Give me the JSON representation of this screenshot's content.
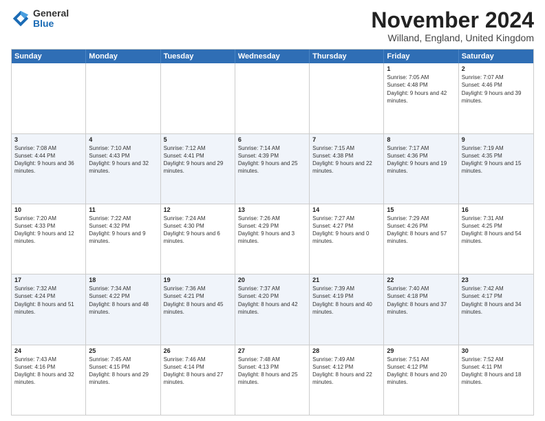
{
  "header": {
    "logo_general": "General",
    "logo_blue": "Blue",
    "month_title": "November 2024",
    "location": "Willand, England, United Kingdom"
  },
  "calendar": {
    "weekdays": [
      "Sunday",
      "Monday",
      "Tuesday",
      "Wednesday",
      "Thursday",
      "Friday",
      "Saturday"
    ],
    "weeks": [
      [
        {
          "day": "",
          "sunrise": "",
          "sunset": "",
          "daylight": ""
        },
        {
          "day": "",
          "sunrise": "",
          "sunset": "",
          "daylight": ""
        },
        {
          "day": "",
          "sunrise": "",
          "sunset": "",
          "daylight": ""
        },
        {
          "day": "",
          "sunrise": "",
          "sunset": "",
          "daylight": ""
        },
        {
          "day": "",
          "sunrise": "",
          "sunset": "",
          "daylight": ""
        },
        {
          "day": "1",
          "sunrise": "Sunrise: 7:05 AM",
          "sunset": "Sunset: 4:48 PM",
          "daylight": "Daylight: 9 hours and 42 minutes."
        },
        {
          "day": "2",
          "sunrise": "Sunrise: 7:07 AM",
          "sunset": "Sunset: 4:46 PM",
          "daylight": "Daylight: 9 hours and 39 minutes."
        }
      ],
      [
        {
          "day": "3",
          "sunrise": "Sunrise: 7:08 AM",
          "sunset": "Sunset: 4:44 PM",
          "daylight": "Daylight: 9 hours and 36 minutes."
        },
        {
          "day": "4",
          "sunrise": "Sunrise: 7:10 AM",
          "sunset": "Sunset: 4:43 PM",
          "daylight": "Daylight: 9 hours and 32 minutes."
        },
        {
          "day": "5",
          "sunrise": "Sunrise: 7:12 AM",
          "sunset": "Sunset: 4:41 PM",
          "daylight": "Daylight: 9 hours and 29 minutes."
        },
        {
          "day": "6",
          "sunrise": "Sunrise: 7:14 AM",
          "sunset": "Sunset: 4:39 PM",
          "daylight": "Daylight: 9 hours and 25 minutes."
        },
        {
          "day": "7",
          "sunrise": "Sunrise: 7:15 AM",
          "sunset": "Sunset: 4:38 PM",
          "daylight": "Daylight: 9 hours and 22 minutes."
        },
        {
          "day": "8",
          "sunrise": "Sunrise: 7:17 AM",
          "sunset": "Sunset: 4:36 PM",
          "daylight": "Daylight: 9 hours and 19 minutes."
        },
        {
          "day": "9",
          "sunrise": "Sunrise: 7:19 AM",
          "sunset": "Sunset: 4:35 PM",
          "daylight": "Daylight: 9 hours and 15 minutes."
        }
      ],
      [
        {
          "day": "10",
          "sunrise": "Sunrise: 7:20 AM",
          "sunset": "Sunset: 4:33 PM",
          "daylight": "Daylight: 9 hours and 12 minutes."
        },
        {
          "day": "11",
          "sunrise": "Sunrise: 7:22 AM",
          "sunset": "Sunset: 4:32 PM",
          "daylight": "Daylight: 9 hours and 9 minutes."
        },
        {
          "day": "12",
          "sunrise": "Sunrise: 7:24 AM",
          "sunset": "Sunset: 4:30 PM",
          "daylight": "Daylight: 9 hours and 6 minutes."
        },
        {
          "day": "13",
          "sunrise": "Sunrise: 7:26 AM",
          "sunset": "Sunset: 4:29 PM",
          "daylight": "Daylight: 9 hours and 3 minutes."
        },
        {
          "day": "14",
          "sunrise": "Sunrise: 7:27 AM",
          "sunset": "Sunset: 4:27 PM",
          "daylight": "Daylight: 9 hours and 0 minutes."
        },
        {
          "day": "15",
          "sunrise": "Sunrise: 7:29 AM",
          "sunset": "Sunset: 4:26 PM",
          "daylight": "Daylight: 8 hours and 57 minutes."
        },
        {
          "day": "16",
          "sunrise": "Sunrise: 7:31 AM",
          "sunset": "Sunset: 4:25 PM",
          "daylight": "Daylight: 8 hours and 54 minutes."
        }
      ],
      [
        {
          "day": "17",
          "sunrise": "Sunrise: 7:32 AM",
          "sunset": "Sunset: 4:24 PM",
          "daylight": "Daylight: 8 hours and 51 minutes."
        },
        {
          "day": "18",
          "sunrise": "Sunrise: 7:34 AM",
          "sunset": "Sunset: 4:22 PM",
          "daylight": "Daylight: 8 hours and 48 minutes."
        },
        {
          "day": "19",
          "sunrise": "Sunrise: 7:36 AM",
          "sunset": "Sunset: 4:21 PM",
          "daylight": "Daylight: 8 hours and 45 minutes."
        },
        {
          "day": "20",
          "sunrise": "Sunrise: 7:37 AM",
          "sunset": "Sunset: 4:20 PM",
          "daylight": "Daylight: 8 hours and 42 minutes."
        },
        {
          "day": "21",
          "sunrise": "Sunrise: 7:39 AM",
          "sunset": "Sunset: 4:19 PM",
          "daylight": "Daylight: 8 hours and 40 minutes."
        },
        {
          "day": "22",
          "sunrise": "Sunrise: 7:40 AM",
          "sunset": "Sunset: 4:18 PM",
          "daylight": "Daylight: 8 hours and 37 minutes."
        },
        {
          "day": "23",
          "sunrise": "Sunrise: 7:42 AM",
          "sunset": "Sunset: 4:17 PM",
          "daylight": "Daylight: 8 hours and 34 minutes."
        }
      ],
      [
        {
          "day": "24",
          "sunrise": "Sunrise: 7:43 AM",
          "sunset": "Sunset: 4:16 PM",
          "daylight": "Daylight: 8 hours and 32 minutes."
        },
        {
          "day": "25",
          "sunrise": "Sunrise: 7:45 AM",
          "sunset": "Sunset: 4:15 PM",
          "daylight": "Daylight: 8 hours and 29 minutes."
        },
        {
          "day": "26",
          "sunrise": "Sunrise: 7:46 AM",
          "sunset": "Sunset: 4:14 PM",
          "daylight": "Daylight: 8 hours and 27 minutes."
        },
        {
          "day": "27",
          "sunrise": "Sunrise: 7:48 AM",
          "sunset": "Sunset: 4:13 PM",
          "daylight": "Daylight: 8 hours and 25 minutes."
        },
        {
          "day": "28",
          "sunrise": "Sunrise: 7:49 AM",
          "sunset": "Sunset: 4:12 PM",
          "daylight": "Daylight: 8 hours and 22 minutes."
        },
        {
          "day": "29",
          "sunrise": "Sunrise: 7:51 AM",
          "sunset": "Sunset: 4:12 PM",
          "daylight": "Daylight: 8 hours and 20 minutes."
        },
        {
          "day": "30",
          "sunrise": "Sunrise: 7:52 AM",
          "sunset": "Sunset: 4:11 PM",
          "daylight": "Daylight: 8 hours and 18 minutes."
        }
      ]
    ]
  }
}
